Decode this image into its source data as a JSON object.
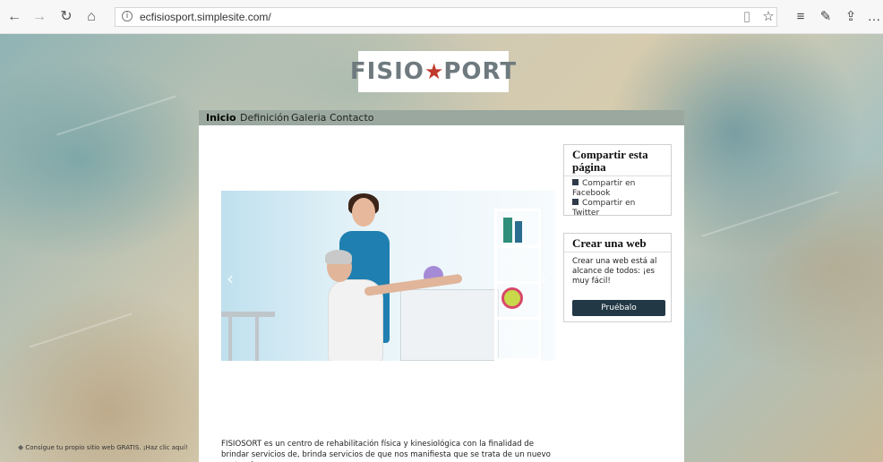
{
  "browser": {
    "url": "ecfisiosport.simplesite.com/",
    "icons": [
      "back-icon",
      "forward-icon",
      "refresh-icon",
      "home-icon",
      "info-icon",
      "reading-view-icon",
      "favorite-star-icon",
      "favorites-list-icon",
      "pen-icon",
      "share-icon",
      "more-icon"
    ]
  },
  "logo": {
    "text": "FISIO",
    "text2": "PORT"
  },
  "nav": {
    "items": [
      "Inicio",
      "Definición",
      "Galeria",
      "Contacto"
    ],
    "active": "Inicio"
  },
  "share_widget": {
    "title": "Compartir esta página",
    "facebook": "Compartir en Facebook",
    "twitter": "Compartir en Twitter"
  },
  "create_widget": {
    "title": "Crear una web",
    "text": "Crear una web está al alcance de todos: ¡es muy fácil!",
    "button": "Pruébalo"
  },
  "intro_text": "FISIOSORT es un centro de rehabilitación física y kinesiológica con la finalidad de brindar servicios de, brinda servicios de que nos manifiesta que se trata de un nuevo centro de",
  "promo": "Consigue tu propio sitio web GRATIS. ¡Haz clic aquí!",
  "slider": {
    "prev": "‹",
    "next": "›"
  }
}
